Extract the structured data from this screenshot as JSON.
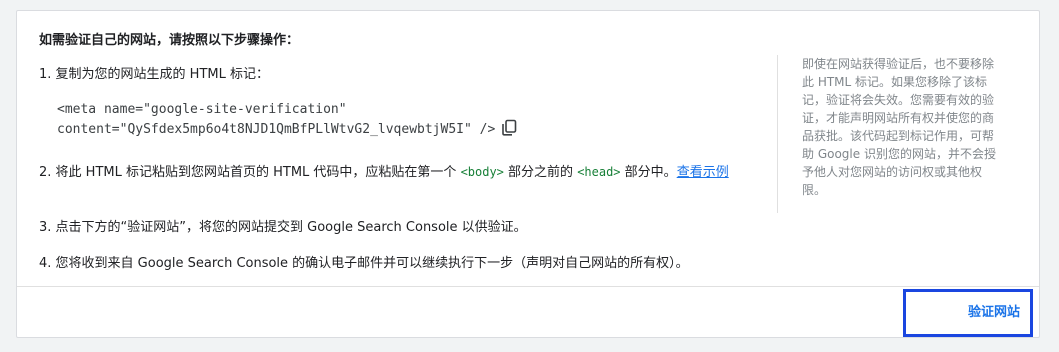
{
  "heading": "如需验证自己的网站，请按照以下步骤操作：",
  "step1": {
    "text": "1. 复制为您的网站生成的 HTML 标记：",
    "code_line1": "<meta name=\"google-site-verification\"",
    "code_line2": "content=\"QySfdex5mp6o4t8NJD1QmBfPLlWtvG2_lvqewbtjW5I\" />",
    "copy_icon": "copy-icon"
  },
  "step2": {
    "part1": "2. 将此 HTML 标记粘贴到您网站首页的 HTML 代码中，应粘贴在第一个 ",
    "tag_body": "<body>",
    "part2": " 部分之前的 ",
    "tag_head": "<head>",
    "part3": " 部分中。",
    "link": "查看示例"
  },
  "step3": "3. 点击下方的“验证网站”，将您的网站提交到 Google Search Console 以供验证。",
  "step4": "4. 您将收到来自 Google Search Console 的确认电子邮件并可以继续执行下一步（声明对自己网站的所有权）。",
  "sidebar_note": "即使在网站获得验证后，也不要移除此 HTML 标记。如果您移除了该标记，验证将会失效。您需要有效的验证，才能声明网站所有权并使您的商品获批。该代码起到标记作用，可帮助 Google 识别您的网站，并不会授予他人对您网站的访问权或其他权限。",
  "verify_button": "验证网站",
  "colors": {
    "link": "#1a73e8",
    "code_tag": "#188038",
    "focus_border": "#1a46e0"
  }
}
